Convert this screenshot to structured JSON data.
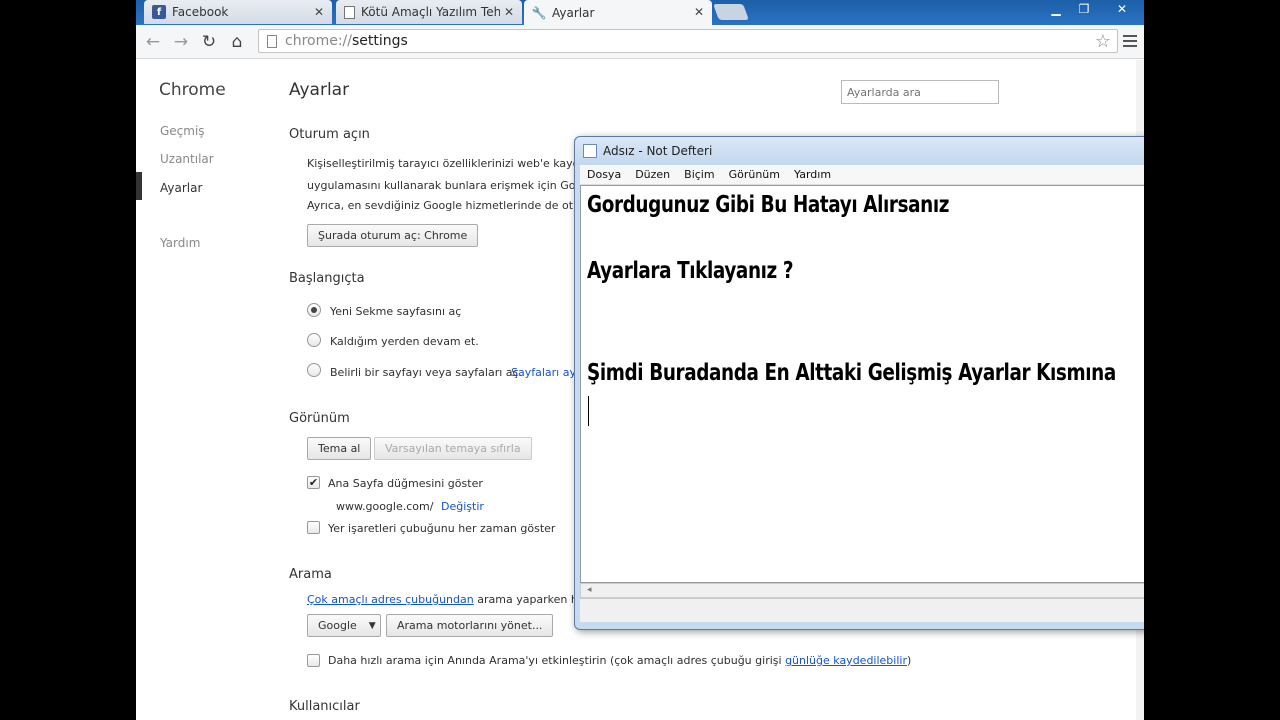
{
  "tabs": [
    {
      "title": "Facebook",
      "icon": "facebook-icon"
    },
    {
      "title": "Kötü Amaçlı Yazılım Tehlikesi",
      "icon": "document-icon"
    },
    {
      "title": "Ayarlar",
      "icon": "wrench-icon"
    }
  ],
  "toolbar": {
    "url_scheme": "chrome://",
    "url_host": "settings"
  },
  "sidebar": {
    "title": "Chrome",
    "items": [
      {
        "label": "Geçmiş"
      },
      {
        "label": "Uzantılar"
      },
      {
        "label": "Ayarlar"
      },
      {
        "label": "Yardım"
      }
    ]
  },
  "page": {
    "title": "Ayarlar",
    "search_placeholder": "Ayarlarda ara"
  },
  "signin": {
    "heading": "Oturum açın",
    "line1": "Kişiselleştirilmiş tarayıcı özelliklerinizi web'e kaydetmek",
    "line2": "uygulamasını kullanarak bunlara erişmek için Google",
    "line3": "Ayrıca, en sevdiğiniz Google hizmetlerinde de oturu",
    "button": "Şurada oturum aç: Chrome"
  },
  "startup": {
    "heading": "Başlangıçta",
    "options": [
      {
        "label": "Yeni Sekme sayfasını aç",
        "selected": true
      },
      {
        "label": "Kaldığım yerden devam et.",
        "selected": false
      },
      {
        "label": "Belirli bir sayfayı veya sayfaları aç.",
        "selected": false
      }
    ],
    "pages_link": "Sayfaları aya"
  },
  "appearance": {
    "heading": "Görünüm",
    "theme_button": "Tema al",
    "reset_button": "Varsayılan temaya sıfırla",
    "home_label": "Ana Sayfa düğmesini göster",
    "home_checked": true,
    "home_url": "www.google.com/",
    "change_link": "Değiştir",
    "bookmarks_label": "Yer işaretleri çubuğunu her zaman göster",
    "bookmarks_checked": false
  },
  "search": {
    "heading": "Arama",
    "omnibox_link": "Çok amaçlı adres çubuğundan",
    "desc_rest": "arama yaparken han",
    "engine": "Google",
    "manage_button": "Arama motorlarını yönet...",
    "instant_label": "Daha hızlı arama için Anında Arama'yı etkinleştirin (çok amaçlı adres çubuğu girişi",
    "instant_link": "günlüğe kaydedilebilir",
    "instant_close": ")"
  },
  "users": {
    "heading": "Kullanıcılar"
  },
  "notepad": {
    "title": "Adsız - Not Defteri",
    "menu": [
      "Dosya",
      "Düzen",
      "Biçim",
      "Görünüm",
      "Yardım"
    ],
    "lines": [
      "Gordugunuz Gibi Bu Hatayı Alırsanız",
      "Ayarlara Tıklayanız ?",
      "Şimdi Buradanda En Alttaki Gelişmiş Ayarlar Kısmına"
    ],
    "hscroll_arrow": "◂"
  },
  "colors": {
    "link": "#1155cc",
    "titlebar": "#2a73c4"
  }
}
